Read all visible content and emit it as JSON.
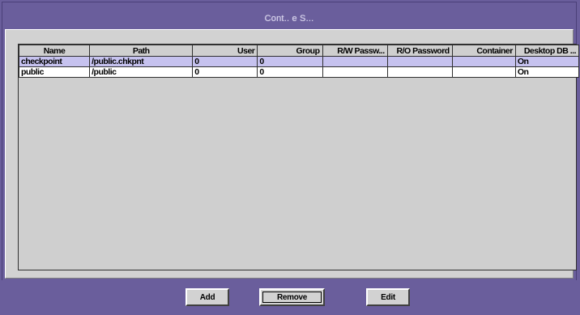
{
  "window": {
    "title": "Cont.. e S..."
  },
  "table": {
    "columns": [
      "Name",
      "Path",
      "User",
      "Group",
      "R/W Passw...",
      "R/O Password",
      "Container",
      "Desktop DB ..."
    ],
    "rows": [
      {
        "cells": [
          "checkpoint",
          "/public.chkpnt",
          "0",
          "0",
          "",
          "",
          "",
          "On"
        ],
        "selected": true
      },
      {
        "cells": [
          "public",
          "/public",
          "0",
          "0",
          "",
          "",
          "",
          "On"
        ],
        "selected": false
      }
    ]
  },
  "buttons": {
    "add": "Add",
    "remove": "Remove",
    "edit": "Edit"
  },
  "colors": {
    "frame": "#6a5e9c",
    "selected_row": "#c6c2ef",
    "panel": "#d2d2d2"
  }
}
